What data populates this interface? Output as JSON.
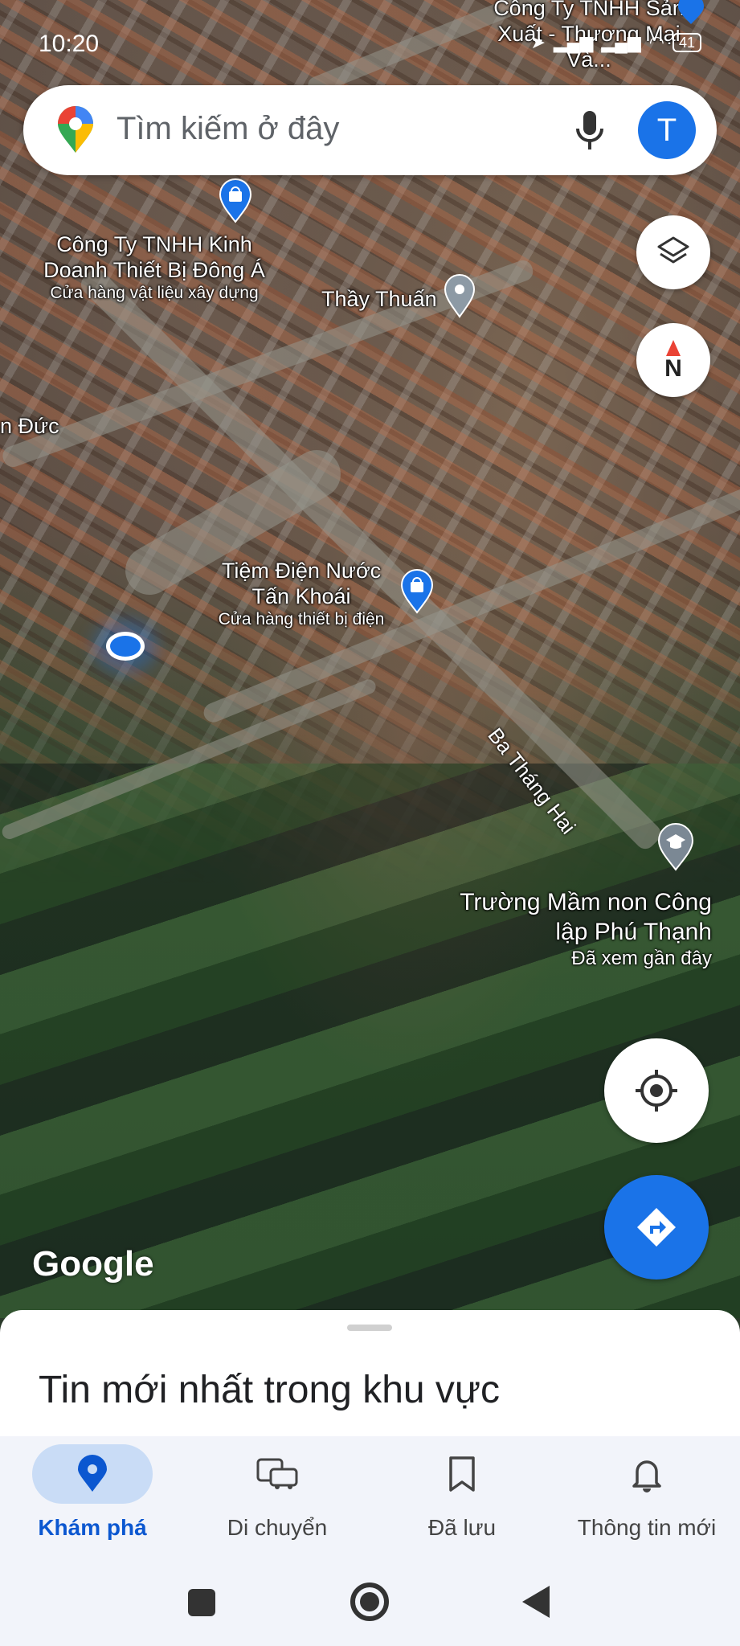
{
  "status_bar": {
    "time": "10:20",
    "battery": "41"
  },
  "search": {
    "placeholder": "Tìm kiếm ở đây",
    "avatar_letter": "T"
  },
  "map": {
    "places": [
      {
        "name": "Công Ty TNHH Sản Xuất - Thương Mại Và...",
        "category": ""
      },
      {
        "name": "Công Ty TNHH Kinh Doanh Thiết Bị Đông Á",
        "category": "Cửa hàng vật liệu xây dựng"
      },
      {
        "name": "Thầy Thuấn",
        "category": ""
      },
      {
        "name": "n Đức",
        "category": ""
      },
      {
        "name": "Tiệm Điện Nước Tấn Khoái",
        "category": "Cửa hàng thiết bị điện"
      },
      {
        "name": "Trường Mầm non Công lập Phú Thạnh",
        "category": "Đã xem gần đây"
      }
    ],
    "road_name": "Ba Tháng Hai",
    "compass_label": "N",
    "attribution": "Google"
  },
  "sheet": {
    "title": "Tin mới nhất trong khu vực"
  },
  "nav": {
    "items": [
      {
        "label": "Khám phá",
        "icon": "location-pin-icon",
        "active": true
      },
      {
        "label": "Di chuyển",
        "icon": "commute-icon",
        "active": false
      },
      {
        "label": "Đã lưu",
        "icon": "bookmark-icon",
        "active": false
      },
      {
        "label": "Thông tin mới",
        "icon": "bell-icon",
        "active": false
      }
    ]
  },
  "colors": {
    "accent": "#1a73e8",
    "active_nav_bg": "#c9dcf6",
    "active_nav_text": "#0b57d0"
  }
}
